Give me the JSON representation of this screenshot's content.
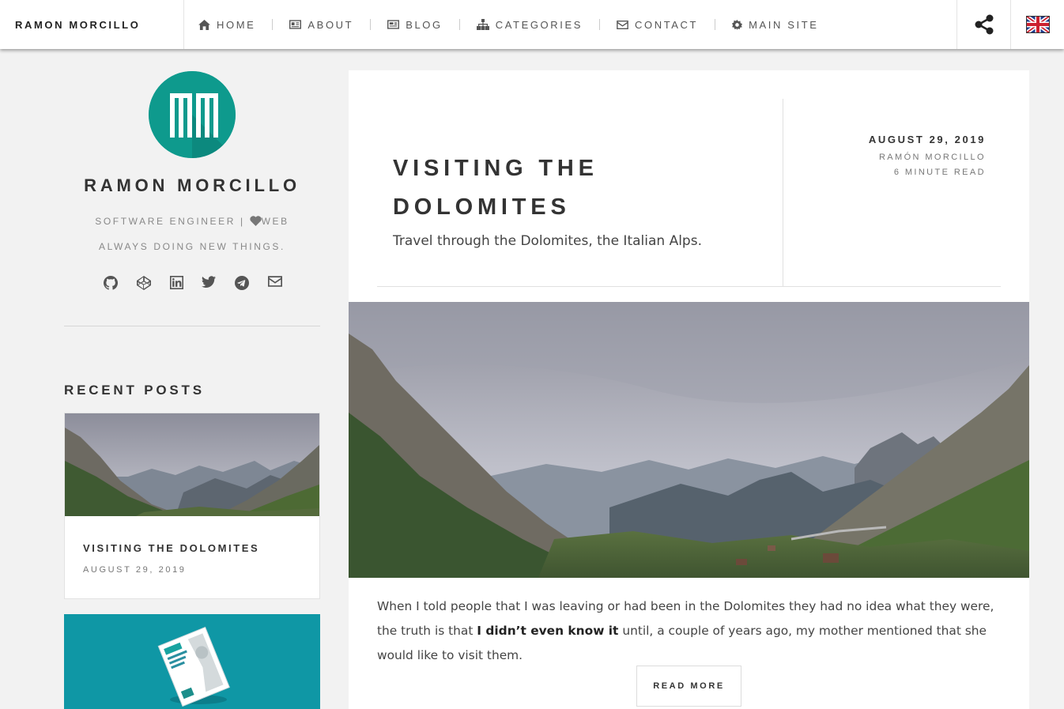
{
  "nav": {
    "brand": "RAMON MORCILLO",
    "items": [
      {
        "label": "HOME",
        "icon": "home-icon"
      },
      {
        "label": "ABOUT",
        "icon": "id-card-icon"
      },
      {
        "label": "BLOG",
        "icon": "newspaper-icon"
      },
      {
        "label": "CATEGORIES",
        "icon": "sitemap-icon"
      },
      {
        "label": "CONTACT",
        "icon": "envelope-icon"
      },
      {
        "label": "MAIN SITE",
        "icon": "gear-icon"
      }
    ]
  },
  "sidebar": {
    "name": "RAMON MORCILLO",
    "tagline_left": "SOFTWARE ENGINEER |",
    "tagline_right": "WEB",
    "tagline2": "ALWAYS DOING NEW THINGS.",
    "recent_title": "RECENT POSTS",
    "recent_posts": [
      {
        "title": "VISITING THE DOLOMITES",
        "date": "AUGUST 29, 2019"
      }
    ]
  },
  "post": {
    "title_line1": "VISITING THE",
    "title_line2": "DOLOMITES",
    "subtitle": "Travel through the Dolomites, the Italian Alps.",
    "date": "AUGUST 29, 2019",
    "author": "RAMÓN MORCILLO",
    "read_time": "6 MINUTE READ",
    "excerpt_part1": "When I told people that I was leaving or had been in the Dolomites they had no idea what they were, the truth is that ",
    "excerpt_bold": "I didn’t even know it",
    "excerpt_part2": " until, a couple of years ago, my mother mentioned that she would like to visit them.",
    "read_more": "READ MORE"
  },
  "colors": {
    "accent": "#0e9a8d",
    "teal_card": "#0f97a5"
  }
}
